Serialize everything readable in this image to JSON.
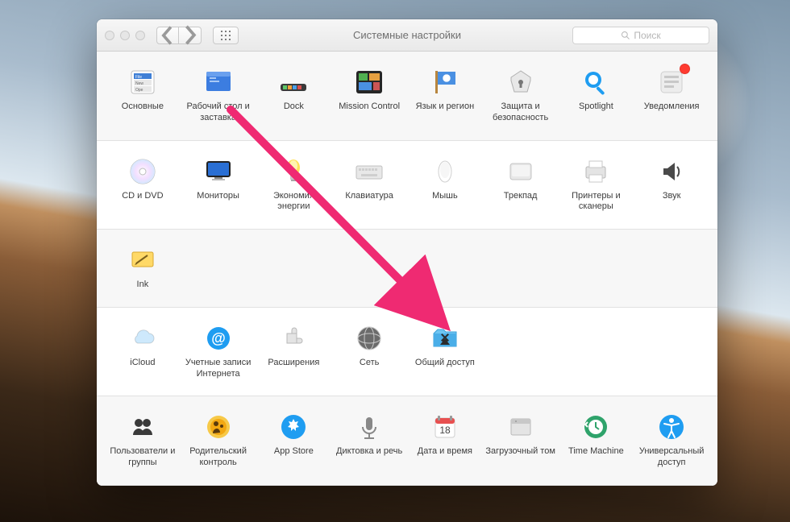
{
  "window": {
    "title": "Системные настройки",
    "search_placeholder": "Поиск"
  },
  "sections": [
    {
      "items": [
        {
          "id": "general",
          "label": "Основные"
        },
        {
          "id": "desktop",
          "label": "Рабочий стол и заставка"
        },
        {
          "id": "dock",
          "label": "Dock"
        },
        {
          "id": "mission",
          "label": "Mission Control"
        },
        {
          "id": "language",
          "label": "Язык и регион"
        },
        {
          "id": "security",
          "label": "Защита и безопасность"
        },
        {
          "id": "spotlight",
          "label": "Spotlight"
        },
        {
          "id": "notifications",
          "label": "Уведомления",
          "badge": true
        }
      ]
    },
    {
      "items": [
        {
          "id": "cddvd",
          "label": "CD и DVD"
        },
        {
          "id": "displays",
          "label": "Мониторы"
        },
        {
          "id": "energy",
          "label": "Экономия энергии"
        },
        {
          "id": "keyboard",
          "label": "Клавиатура"
        },
        {
          "id": "mouse",
          "label": "Мышь"
        },
        {
          "id": "trackpad",
          "label": "Трекпад"
        },
        {
          "id": "printers",
          "label": "Принтеры и сканеры"
        },
        {
          "id": "sound",
          "label": "Звук"
        }
      ]
    },
    {
      "items": [
        {
          "id": "ink",
          "label": "Ink"
        }
      ]
    },
    {
      "items": [
        {
          "id": "icloud",
          "label": "iCloud"
        },
        {
          "id": "internet",
          "label": "Учетные записи Интернета"
        },
        {
          "id": "extensions",
          "label": "Расширения"
        },
        {
          "id": "network",
          "label": "Сеть"
        },
        {
          "id": "sharing",
          "label": "Общий доступ"
        }
      ]
    },
    {
      "items": [
        {
          "id": "users",
          "label": "Пользователи и группы"
        },
        {
          "id": "parental",
          "label": "Родительский контроль"
        },
        {
          "id": "appstore",
          "label": "App Store"
        },
        {
          "id": "dictation",
          "label": "Диктовка и речь"
        },
        {
          "id": "datetime",
          "label": "Дата и время"
        },
        {
          "id": "startup",
          "label": "Загрузочный том"
        },
        {
          "id": "timemachine",
          "label": "Time Machine"
        },
        {
          "id": "accessibility",
          "label": "Универсальный доступ"
        }
      ]
    }
  ],
  "annotation": {
    "arrow_target": "sharing"
  }
}
